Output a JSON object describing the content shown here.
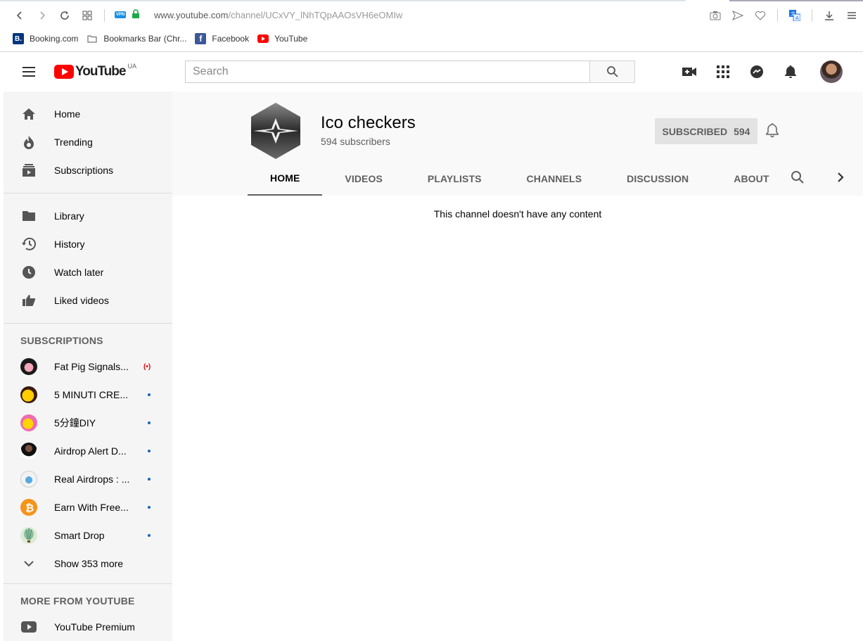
{
  "browser": {
    "url_host": "www.youtube.com",
    "url_path": "/channel/UCxVY_lNhTQpAAOsVH6eOMIw",
    "vpn_label": "VPN",
    "bookmarks": [
      {
        "label": "Booking.com",
        "icon": "booking-icon",
        "color": "#003580",
        "glyph": "B."
      },
      {
        "label": "Bookmarks Bar (Chr...",
        "icon": "folder-icon"
      },
      {
        "label": "Facebook",
        "icon": "facebook-icon",
        "color": "#3b5998",
        "glyph": "f"
      },
      {
        "label": "YouTube",
        "icon": "youtube-icon",
        "color": "#ff0000"
      }
    ]
  },
  "masthead": {
    "logo_text": "YouTube",
    "region": "UA",
    "search_placeholder": "Search"
  },
  "guide": {
    "main": [
      {
        "label": "Home",
        "icon": "home-icon"
      },
      {
        "label": "Trending",
        "icon": "trending-icon"
      },
      {
        "label": "Subscriptions",
        "icon": "subscriptions-icon"
      }
    ],
    "library": [
      {
        "label": "Library",
        "icon": "library-icon"
      },
      {
        "label": "History",
        "icon": "history-icon"
      },
      {
        "label": "Watch later",
        "icon": "watch-later-icon"
      },
      {
        "label": "Liked videos",
        "icon": "liked-videos-icon"
      }
    ],
    "subscriptions_heading": "SUBSCRIPTIONS",
    "subscriptions": [
      {
        "label": "Fat Pig Signals...",
        "status": "live",
        "avatar_color": "#1a1a1a"
      },
      {
        "label": "5 MINUTI CRE...",
        "status": "new",
        "avatar_color": "#e0a000"
      },
      {
        "label": "5分鐘DIY",
        "status": "new",
        "avatar_color": "#f06ab0"
      },
      {
        "label": "Airdrop Alert D...",
        "status": "new",
        "avatar_color": "#6b4a3a"
      },
      {
        "label": "Real Airdrops : ...",
        "status": "new",
        "avatar_color": "#5aa8e0"
      },
      {
        "label": "Earn With Free...",
        "status": "new",
        "avatar_color": "#f7931a"
      },
      {
        "label": "Smart Drop",
        "status": "new",
        "avatar_color": "#9ac08a"
      }
    ],
    "show_more": "Show 353 more",
    "more_heading": "MORE FROM YOUTUBE",
    "more": [
      {
        "label": "YouTube Premium",
        "icon": "youtube-premium-icon"
      }
    ]
  },
  "channel": {
    "name": "Ico checkers",
    "subscribers": "594 subscribers",
    "subscribe_label": "SUBSCRIBED",
    "subscribe_count": "594",
    "tabs": [
      "HOME",
      "VIDEOS",
      "PLAYLISTS",
      "CHANNELS",
      "DISCUSSION",
      "ABOUT"
    ],
    "active_tab": "HOME",
    "empty_message": "This channel doesn't have any content"
  }
}
